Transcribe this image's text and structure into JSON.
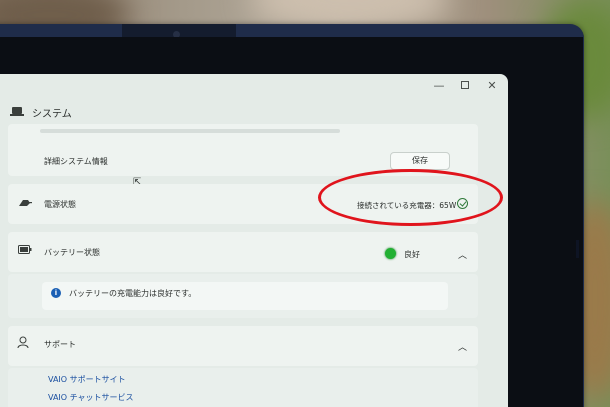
{
  "window": {
    "title": "システム",
    "controls": {
      "minimize": "—",
      "maximize": "",
      "close": "✕"
    }
  },
  "rows": {
    "detail_info": {
      "label": "詳細システム情報",
      "button": "保存"
    },
    "power": {
      "label": "電源状態",
      "status": "接続されている充電器：65W"
    },
    "battery": {
      "label": "バッテリー状態",
      "status": "良好",
      "message": "バッテリーの充電能力は良好です。"
    },
    "support": {
      "label": "サポート",
      "links": [
        "VAIO サポートサイト",
        "VAIO チャットサービス"
      ]
    }
  },
  "colors": {
    "annotation": "#e0141c",
    "status_good": "#22b033",
    "check": "#2f7a3a"
  },
  "icons": [
    "laptop-icon",
    "power-plug-icon",
    "battery-icon",
    "info-icon",
    "headset-icon",
    "check-circle-icon",
    "chevron-up-icon"
  ]
}
